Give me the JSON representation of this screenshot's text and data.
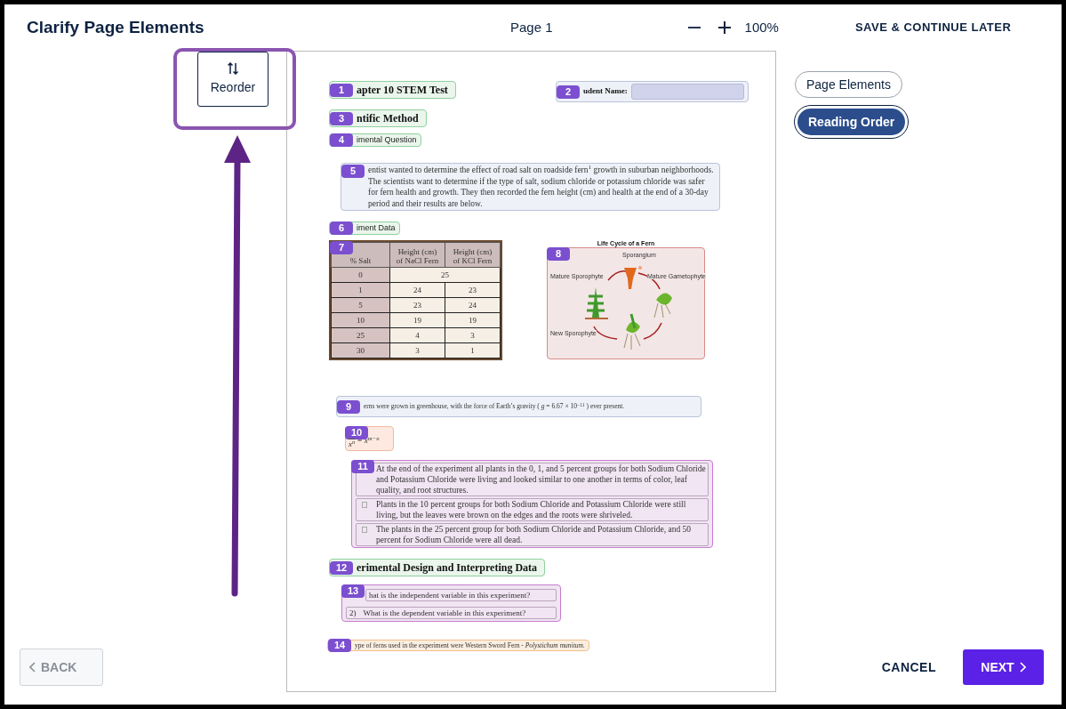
{
  "header": {
    "title": "Clarify Page Elements",
    "page_label": "Page 1",
    "zoom": "100%",
    "save": "SAVE & CONTINUE LATER"
  },
  "reorder_button": {
    "label": "Reorder"
  },
  "view_toggle": [
    {
      "label": "Page Elements",
      "selected": false
    },
    {
      "label": "Reading Order",
      "selected": true
    }
  ],
  "page_rows": [
    {
      "elements": [
        {
          "number": "1",
          "kind": "heading",
          "text": "apter 10 STEM Test"
        },
        {
          "number": "2",
          "kind": "field",
          "label": "udent Name:"
        }
      ]
    },
    {
      "elements": [
        {
          "number": "3",
          "kind": "heading",
          "text": "ntific Method"
        }
      ]
    },
    {
      "elements": [
        {
          "number": "4",
          "kind": "subheading",
          "text": "imental Question"
        }
      ]
    },
    {
      "elements": [
        {
          "number": "5",
          "kind": "paragraph",
          "text": "entist wanted to determine the effect of road salt on roadside fern$^{1}$ growth in suburban neighborhoods. The scientists want to determine if the type of salt, sodium chloride or potassium chloride was safer for fern health and growth. They then recorded the fern height (cm) and health at the end of a 30-day period and their results are below."
        }
      ]
    },
    {
      "elements": [
        {
          "number": "6",
          "kind": "subheading",
          "text": "iment Data"
        }
      ]
    },
    {
      "elements": [
        {
          "number": "7",
          "kind": "table",
          "columns": [
            "% Salt",
            "Height (cm) of NaCl Fern",
            "Height (cm) of KCl Fern"
          ],
          "rows": [
            [
              "0",
              {
                "text": "25",
                "colspan": 2
              }
            ],
            [
              "1",
              "24",
              "23"
            ],
            [
              "5",
              "23",
              "24"
            ],
            [
              "10",
              "19",
              "19"
            ],
            [
              "25",
              "4",
              "3"
            ],
            [
              "30",
              "3",
              "1"
            ]
          ]
        },
        {
          "number": "8",
          "kind": "figure",
          "title": "Life Cycle of a Fern",
          "labels": [
            "Sporangium",
            "Mature Sporophyte",
            "Mature Gametophyte",
            "New Sporophyte"
          ]
        }
      ]
    },
    {
      "elements": [
        {
          "number": "9",
          "kind": "text",
          "text": "erns were grown in greenhouse, with the force of Earth’s gravity (  *g* = 6.67 × 10$^{−11}$  ) ever present."
        }
      ]
    },
    {
      "elements": [
        {
          "number": "10",
          "kind": "equation",
          "denominator": "x$^{n}$",
          "result": "= x$^{m−n}$"
        }
      ]
    },
    {
      "elements": [
        {
          "number": "11",
          "kind": "list",
          "items": [
            {
              "bullet": false,
              "text": "At the end of the experiment all plants in the 0, 1, and 5 percent groups for both Sodium Chloride and Potassium Chloride were living and looked similar to one another in terms of color, leaf quality, and root structures."
            },
            {
              "bullet": true,
              "text": "Plants in the 10 percent groups for both Sodium Chloride and Potassium Chloride were still living, but the leaves were brown on the edges and the roots were shriveled."
            },
            {
              "bullet": true,
              "text": "The plants in the 25 percent group for both Sodium Chloride and Potassium Chloride, and 50 percent for Sodium Chloride were all dead."
            }
          ]
        }
      ]
    },
    {
      "elements": [
        {
          "number": "12",
          "kind": "heading",
          "text": "erimental Design and Interpreting Data"
        }
      ]
    },
    {
      "elements": [
        {
          "number": "13",
          "kind": "list",
          "items": [
            {
              "text": "hat is the independent variable in this experiment?"
            },
            {
              "marker": "2)",
              "text": "What is the dependent variable in this experiment?"
            }
          ]
        }
      ]
    },
    {
      "elements": [
        {
          "number": "14",
          "kind": "footnote",
          "text": "ype of ferns used in the experiment were Western Sword Fern - *Polystichum munitum.*"
        }
      ]
    }
  ],
  "footer": {
    "back": "BACK",
    "back_disabled": true,
    "cancel": "CANCEL",
    "next": "NEXT"
  }
}
